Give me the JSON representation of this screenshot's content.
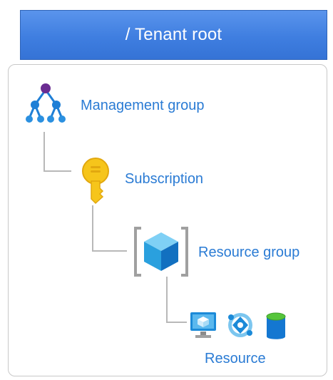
{
  "root": {
    "title": "/ Tenant root"
  },
  "hierarchy": {
    "management_group": {
      "label": "Management group",
      "icon": "management-group-icon"
    },
    "subscription": {
      "label": "Subscription",
      "icon": "key-icon"
    },
    "resource_group": {
      "label": "Resource group",
      "icon": "resource-group-icon"
    },
    "resource": {
      "label": "Resource",
      "icons": [
        "virtual-machine-icon",
        "network-icon",
        "storage-icon"
      ]
    }
  },
  "colors": {
    "banner": "#3f7ee0",
    "label": "#2a7bd4",
    "connector": "#b8b8b8",
    "mg_purple": "#6a2c91",
    "mg_blue": "#1f7fd6",
    "key_yellow": "#f6c51b",
    "azure_blue": "#0f78d4"
  }
}
